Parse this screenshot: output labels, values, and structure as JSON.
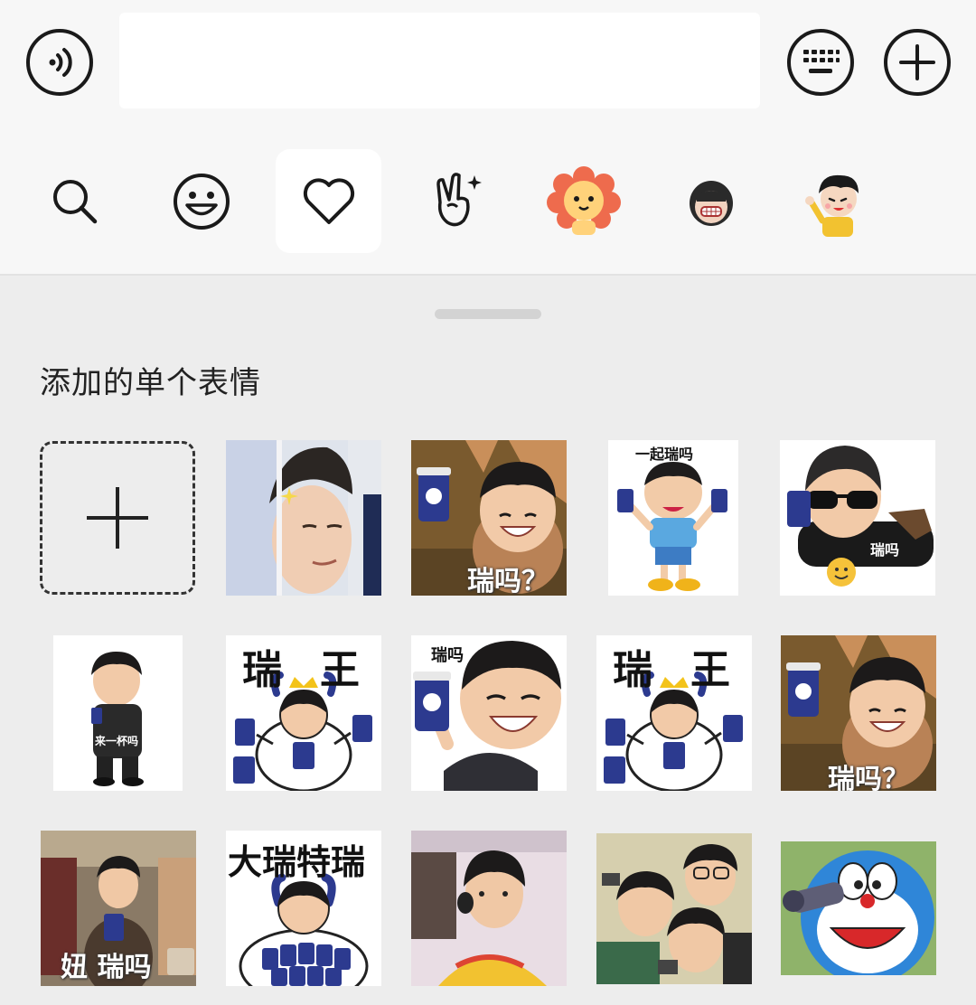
{
  "input": {
    "placeholder": "",
    "value": ""
  },
  "icons": {
    "voice": "voice-icon",
    "keyboard": "keyboard-icon",
    "more": "plus-icon",
    "tabs": [
      "search-icon",
      "emoji-icon",
      "heart-icon",
      "hand-gesture-icon",
      "lion-sticker-icon",
      "girl-sticker-icon",
      "boy-sticker-icon"
    ]
  },
  "section": {
    "title": "添加的单个表情"
  },
  "stickers": {
    "s1_3": "瑞吗？",
    "s1_4": "一起瑞吗",
    "s1_5": "瑞吗",
    "s2_1": "来一杯吗",
    "s2_2a": "瑞",
    "s2_2b": "王",
    "s2_3": "瑞吗",
    "s2_4a": "瑞",
    "s2_4b": "王",
    "s2_5": "瑞吗？",
    "s3_1": "妞 瑞吗",
    "s3_2": "大瑞特瑞"
  },
  "colors": {
    "accent": "#1a1a1a",
    "background": "#ededed",
    "topbar": "#f7f7f7",
    "coffee_blue": "#2c3a8f"
  }
}
